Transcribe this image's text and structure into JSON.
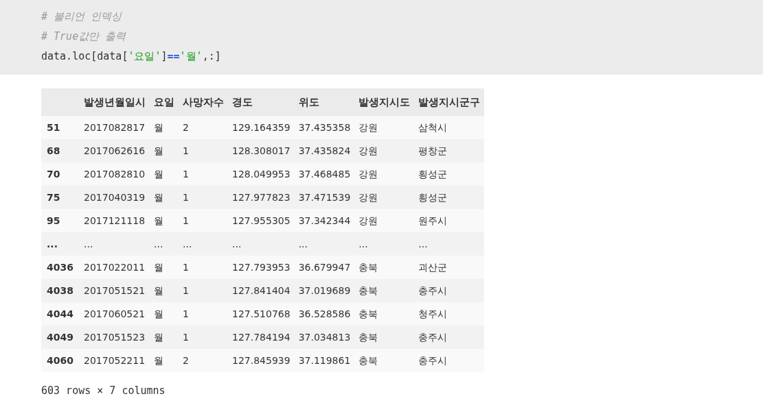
{
  "code_cell": {
    "lines": [
      [
        {
          "kind": "comment",
          "text": "# 불리언 인덱싱"
        }
      ],
      [
        {
          "kind": "comment",
          "text": "# True값만 출력"
        }
      ],
      [
        {
          "kind": "plain",
          "text": "data.loc[data["
        },
        {
          "kind": "string",
          "text": "'요일'"
        },
        {
          "kind": "plain",
          "text": "]"
        },
        {
          "kind": "operator",
          "text": "=="
        },
        {
          "kind": "string",
          "text": "'월'"
        },
        {
          "kind": "plain",
          "text": ",:]"
        }
      ]
    ]
  },
  "table": {
    "columns": [
      "",
      "발생년월일시",
      "요일",
      "사망자수",
      "경도",
      "위도",
      "발생지시도",
      "발생지시군구"
    ],
    "rows": [
      [
        "51",
        "2017082817",
        "월",
        "2",
        "129.164359",
        "37.435358",
        "강원",
        "삼척시"
      ],
      [
        "68",
        "2017062616",
        "월",
        "1",
        "128.308017",
        "37.435824",
        "강원",
        "평창군"
      ],
      [
        "70",
        "2017082810",
        "월",
        "1",
        "128.049953",
        "37.468485",
        "강원",
        "횡성군"
      ],
      [
        "75",
        "2017040319",
        "월",
        "1",
        "127.977823",
        "37.471539",
        "강원",
        "횡성군"
      ],
      [
        "95",
        "2017121118",
        "월",
        "1",
        "127.955305",
        "37.342344",
        "강원",
        "원주시"
      ],
      [
        "...",
        "...",
        "...",
        "...",
        "...",
        "...",
        "...",
        "..."
      ],
      [
        "4036",
        "2017022011",
        "월",
        "1",
        "127.793953",
        "36.679947",
        "충북",
        "괴산군"
      ],
      [
        "4038",
        "2017051521",
        "월",
        "1",
        "127.841404",
        "37.019689",
        "충북",
        "충주시"
      ],
      [
        "4044",
        "2017060521",
        "월",
        "1",
        "127.510768",
        "36.528586",
        "충북",
        "청주시"
      ],
      [
        "4049",
        "2017051523",
        "월",
        "1",
        "127.784194",
        "37.034813",
        "충북",
        "충주시"
      ],
      [
        "4060",
        "2017052211",
        "월",
        "2",
        "127.845939",
        "37.119861",
        "충북",
        "충주시"
      ]
    ]
  },
  "footer": "603 rows × 7 columns"
}
